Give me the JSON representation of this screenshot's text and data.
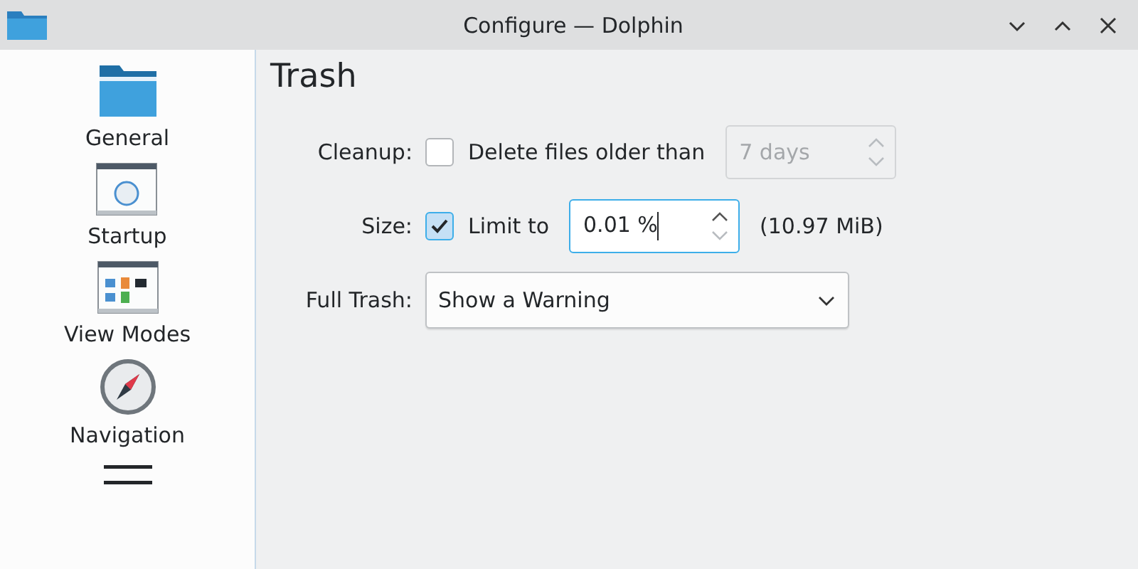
{
  "window": {
    "title": "Configure — Dolphin",
    "controls": [
      {
        "kind": "minimize"
      },
      {
        "kind": "maximize"
      },
      {
        "kind": "close"
      }
    ]
  },
  "sidebar": {
    "items": [
      {
        "kind": "folder",
        "label": "General",
        "selected": false
      },
      {
        "kind": "startup",
        "label": "Startup",
        "selected": false
      },
      {
        "kind": "viewmodes",
        "label": "View Modes",
        "selected": false
      },
      {
        "kind": "compass",
        "label": "Navigation",
        "selected": false
      },
      {
        "kind": "menu",
        "selected": false
      }
    ]
  },
  "page": {
    "title": "Trash",
    "cleanup": {
      "label": "Cleanup:",
      "checkbox": {
        "label": "Delete files older than",
        "checked": false
      },
      "spinbox": {
        "value": "7 days",
        "disabled": true,
        "focused": false
      }
    },
    "size": {
      "label": "Size:",
      "checkbox": {
        "label": "Limit to",
        "checked": true
      },
      "spinbox": {
        "value": "0.01 %",
        "disabled": false,
        "focused": true
      },
      "note": "(10.97 MiB)"
    },
    "full_trash": {
      "label": "Full Trash:",
      "value": "Show a Warning"
    }
  }
}
